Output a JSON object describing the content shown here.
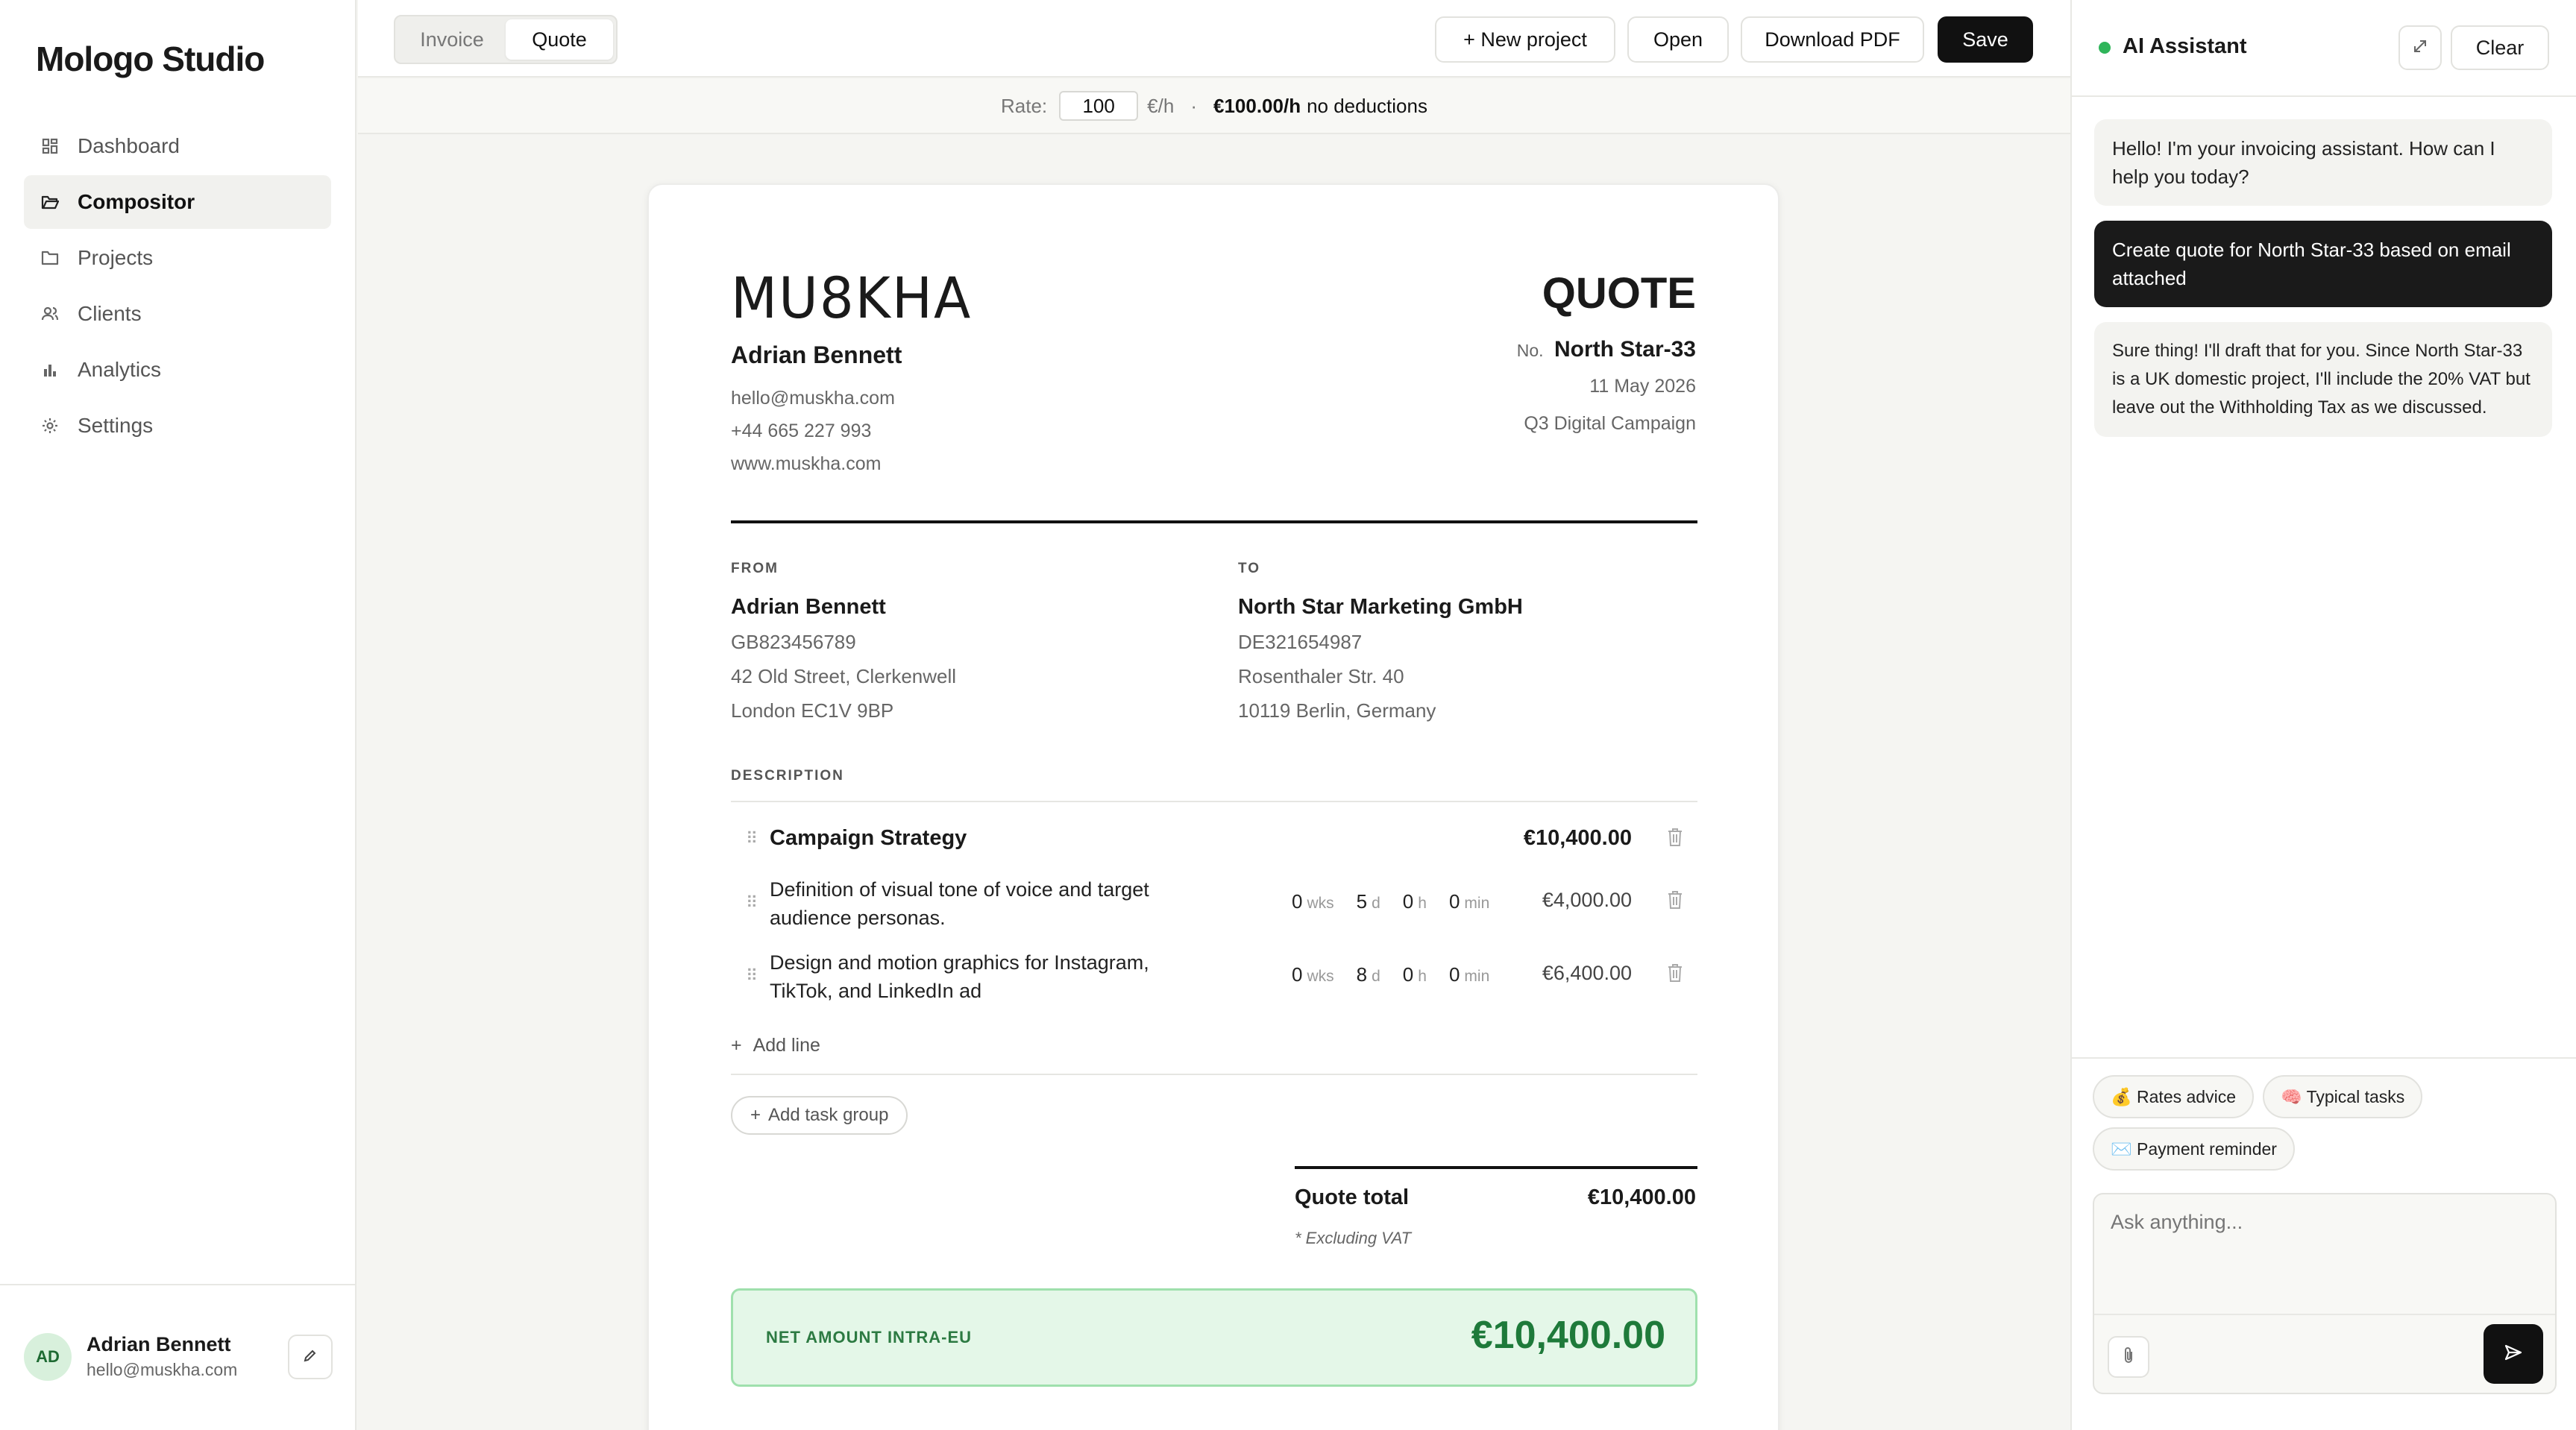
{
  "sidebar": {
    "brand": "Mologo Studio",
    "items": [
      {
        "label": "Dashboard",
        "icon": "dashboard-icon"
      },
      {
        "label": "Compositor",
        "icon": "folder-open-icon"
      },
      {
        "label": "Projects",
        "icon": "folder-icon"
      },
      {
        "label": "Clients",
        "icon": "users-icon"
      },
      {
        "label": "Analytics",
        "icon": "bar-chart-icon"
      },
      {
        "label": "Settings",
        "icon": "gear-icon"
      }
    ],
    "active": "Compositor",
    "user": {
      "initials": "AD",
      "name": "Adrian Bennett",
      "email": "hello@muskha.com"
    }
  },
  "toolbar": {
    "tabs": [
      "Invoice",
      "Quote"
    ],
    "selected_tab": "Quote",
    "new_project": "+ New project",
    "open": "Open",
    "download": "Download PDF",
    "save": "Save"
  },
  "rate": {
    "label": "Rate:",
    "value": "100",
    "unit": "€/h",
    "sep": "·",
    "summary": "€100.00/h",
    "summary_note": "no deductions"
  },
  "doc": {
    "logo": "MU8KHA",
    "title": "QUOTE",
    "sender_name": "Adrian Bennett",
    "contact": [
      "hello@muskha.com",
      "+44 665 227 993",
      "www.muskha.com"
    ],
    "number_label": "No.",
    "number": "North Star-33",
    "date": "11 May 2026",
    "project": "Q3 Digital Campaign",
    "from": {
      "label": "FROM",
      "name": "Adrian Bennett",
      "lines": [
        "GB823456789",
        "42 Old Street, Clerkenwell",
        "London EC1V 9BP"
      ]
    },
    "to": {
      "label": "TO",
      "name": "North Star Marketing GmbH",
      "lines": [
        "DE321654987",
        "Rosenthaler Str. 40",
        "10119 Berlin, Germany"
      ]
    },
    "description_label": "DESCRIPTION",
    "group": {
      "name": "Campaign Strategy",
      "total": "€10,400.00"
    },
    "lines": [
      {
        "desc1": "Definition of visual tone of voice and target",
        "desc2": "audience personas.",
        "wks": "0",
        "d": "5",
        "h": "0",
        "min": "0",
        "amount": "€4,000.00"
      },
      {
        "desc1": "Design and motion graphics for Instagram,",
        "desc2": "TikTok, and LinkedIn ad",
        "wks": "0",
        "d": "8",
        "h": "0",
        "min": "0",
        "amount": "€6,400.00"
      }
    ],
    "units": {
      "wks": "wks",
      "d": "d",
      "h": "h",
      "min": "min"
    },
    "add_line": "Add line",
    "add_group": "Add task group",
    "total_label": "Quote total",
    "total": "€10,400.00",
    "vat_note": "* Excluding VAT",
    "net_label": "NET AMOUNT INTRA-EU",
    "net_amount": "€10,400.00"
  },
  "assistant": {
    "title": "AI Assistant",
    "clear": "Clear",
    "messages": [
      {
        "role": "assistant",
        "text": "Hello! I'm your invoicing assistant. How can I help you today?"
      },
      {
        "role": "user",
        "text": "Create quote for North Star-33 based on email attached"
      },
      {
        "role": "assistant",
        "text": "Sure thing! I'll draft that for you. Since North Star-33 is a UK domestic project, I'll include the 20% VAT but leave out the Withholding Tax as we discussed."
      }
    ],
    "chips": [
      "💰 Rates advice",
      "🧠 Typical tasks",
      "✉️ Payment reminder"
    ],
    "placeholder": "Ask anything..."
  },
  "colors": {
    "accent_green": "#1e7a3a",
    "dark": "#111111",
    "status_dot": "#2fb55a"
  }
}
